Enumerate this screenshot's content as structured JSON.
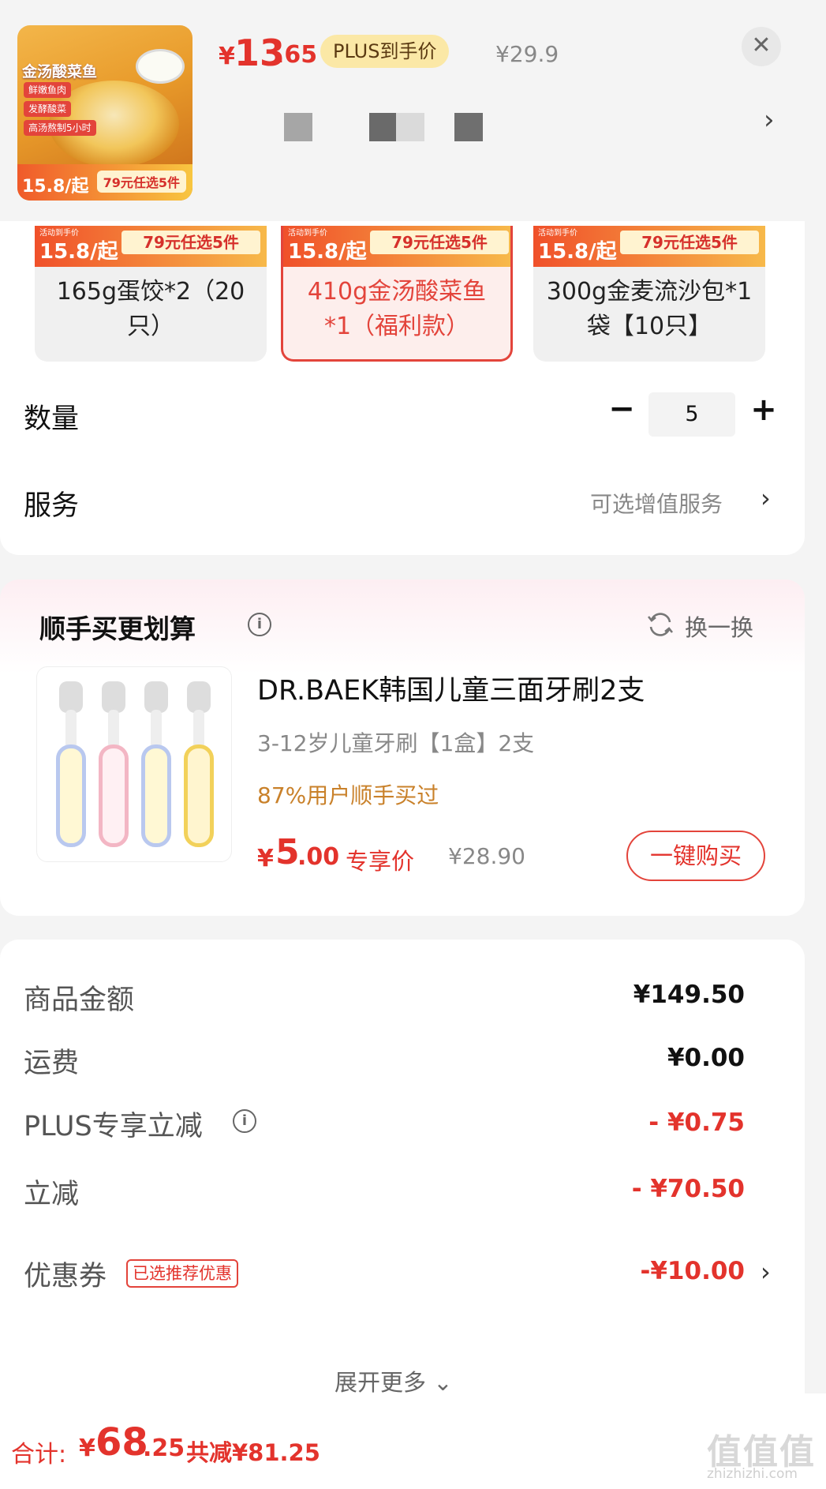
{
  "header": {
    "thumbnail": {
      "title": "金汤酸菜鱼",
      "tags": [
        "鲜嫩鱼肉",
        "发酵酸菜",
        "高汤熬制5小时"
      ],
      "band_price": "15.8/起",
      "band_badge": "79元任选5件"
    },
    "price": {
      "currency": "¥",
      "int": "13",
      "dec": ".65"
    },
    "plus_badge": "PLUS到手价",
    "original_price": "¥29.9",
    "close_symbol": "✕",
    "chevron": "›"
  },
  "options": [
    {
      "strip_price": "15.8/起",
      "strip_badge": "79元任选5件",
      "strip_tiny": "活动到手价",
      "label": "165g蛋饺*2（20只）",
      "selected": false
    },
    {
      "strip_price": "15.8/起",
      "strip_badge": "79元任选5件",
      "strip_tiny": "活动到手价",
      "label": "410g金汤酸菜鱼*1（福利款）",
      "selected": true
    },
    {
      "strip_price": "15.8/起",
      "strip_badge": "79元任选5件",
      "strip_tiny": "活动到手价",
      "label": "300g金麦流沙包*1袋【10只】",
      "selected": false
    }
  ],
  "quantity": {
    "label": "数量",
    "value": "5",
    "minus": "−",
    "plus": "+"
  },
  "service": {
    "label": "服务",
    "value": "可选增值服务",
    "chevron": "›"
  },
  "upsell": {
    "title": "顺手买更划算",
    "info": "i",
    "refresh_label": "换一换",
    "product": {
      "name": "DR.BAEK韩国儿童三面牙刷2支",
      "spec": "3-12岁儿童牙刷【1盒】2支",
      "stat": "87%用户顺手买过",
      "price_cur": "¥",
      "price_int": "5",
      "price_dec": ".00",
      "exclusive": "专享价",
      "orig_price": "¥28.90",
      "buy_label": "一键购买"
    }
  },
  "summary": {
    "rows": [
      {
        "label": "商品金额",
        "value": "¥149.50"
      },
      {
        "label": "运费",
        "value": "¥0.00"
      },
      {
        "label": "PLUS专享立减",
        "value": "- ¥0.75"
      },
      {
        "label": "立减",
        "value": "- ¥70.50"
      },
      {
        "label": "优惠券",
        "value": "-¥10.00"
      }
    ],
    "coupon_tag": "已选推荐优惠",
    "expand_label": "展开更多 ⌄"
  },
  "bottom": {
    "total_label": "合计:",
    "total_cur": "¥",
    "total_int": "68",
    "total_dec": ".25",
    "saved": "共减¥81.25",
    "watermark": "值值值",
    "watermark_url": "zhizhizhi.com"
  },
  "colors": {
    "accent": "#e3332c",
    "plus_badge_bg": "#fbe8a6",
    "stat_orange": "#c9812a"
  }
}
